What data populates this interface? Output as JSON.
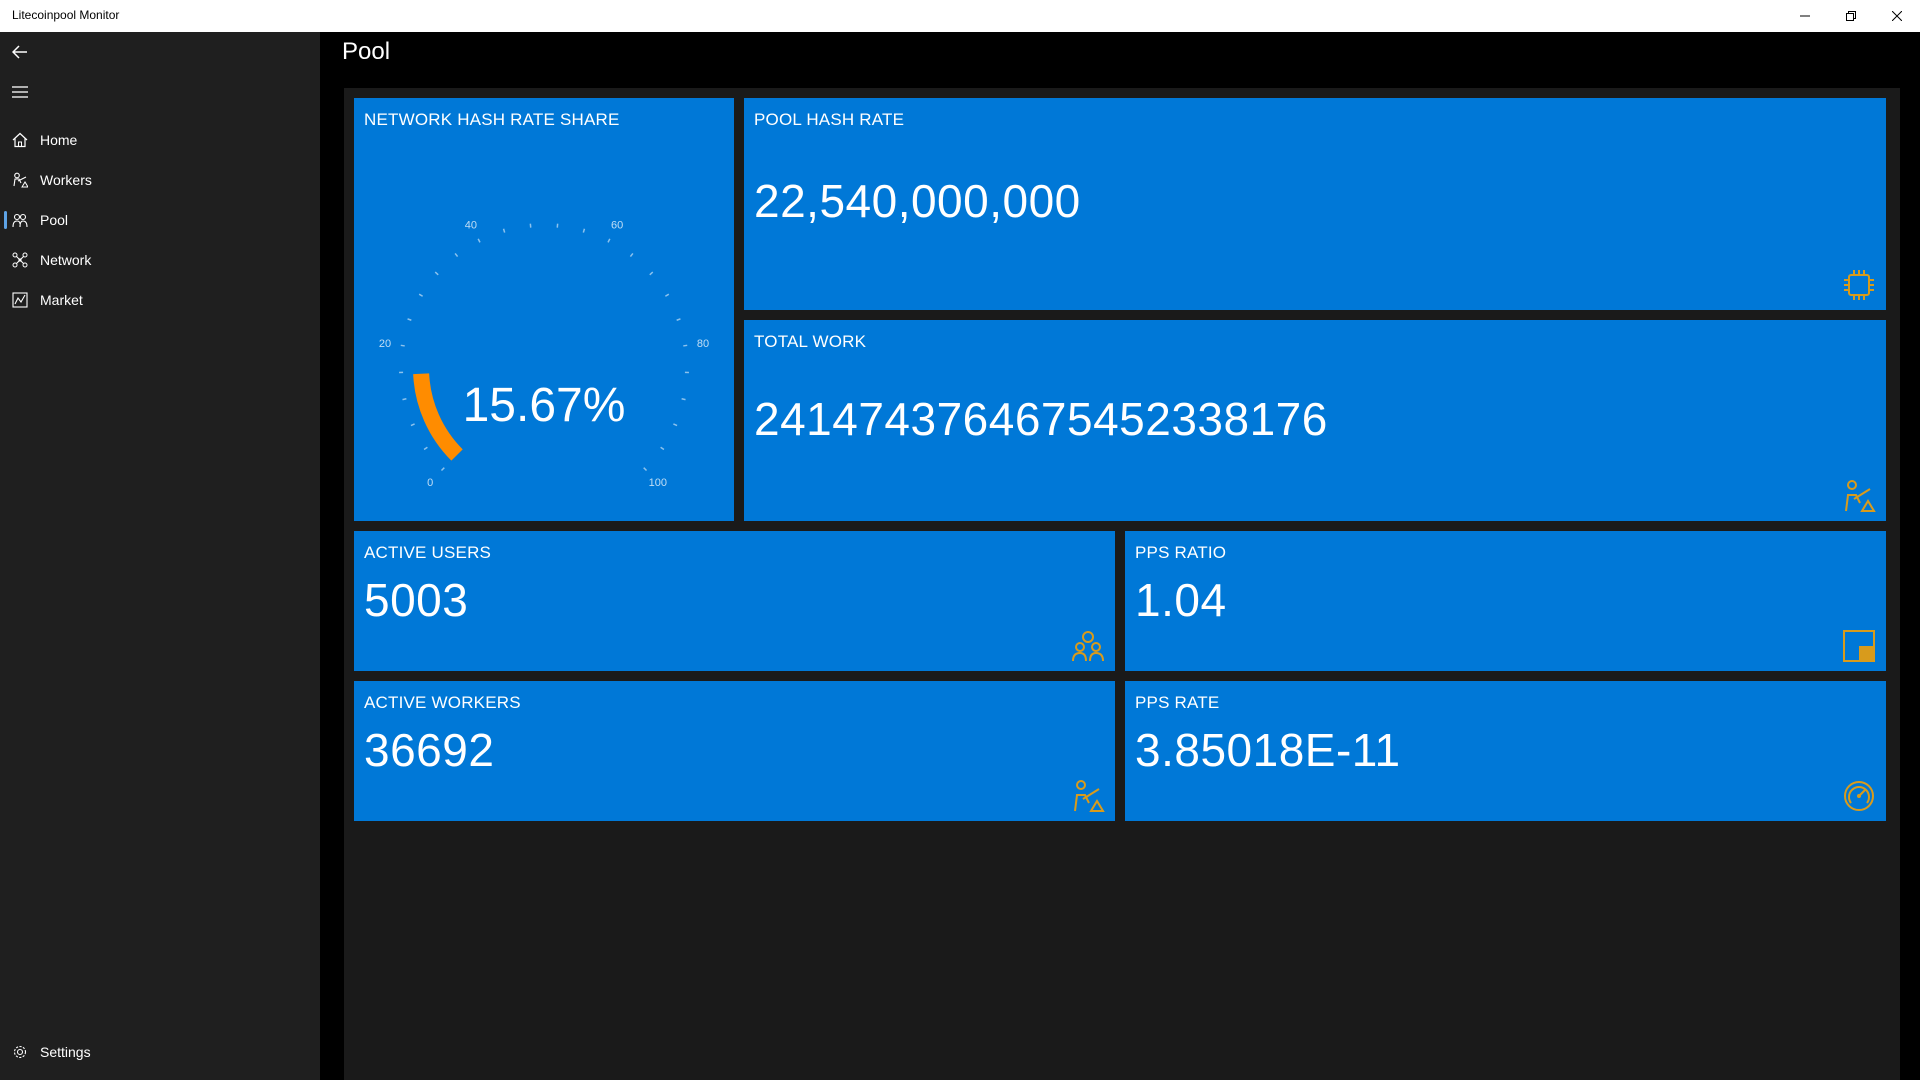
{
  "window": {
    "title": "Litecoinpool Monitor"
  },
  "nav": {
    "items": [
      {
        "label": "Home",
        "icon": "home-icon"
      },
      {
        "label": "Workers",
        "icon": "workers-icon"
      },
      {
        "label": "Pool",
        "icon": "pool-icon",
        "selected": true
      },
      {
        "label": "Network",
        "icon": "network-icon"
      },
      {
        "label": "Market",
        "icon": "market-icon"
      }
    ],
    "settings_label": "Settings"
  },
  "header": {
    "title": "Pool"
  },
  "tiles": {
    "network_share": {
      "label": "NETWORK HASH RATE SHARE",
      "value": "15.67%",
      "gauge_min": 0,
      "gauge_max": 100,
      "gauge_value": 15.67,
      "tick_labels": [
        "0",
        "20",
        "40",
        "60",
        "80",
        "100"
      ]
    },
    "pool_hash_rate": {
      "label": "POOL HASH RATE",
      "value": "22,540,000,000",
      "icon": "cpu-icon"
    },
    "total_work": {
      "label": "TOTAL WORK",
      "value": "241474376467545233817​6",
      "icon": "worker-icon"
    },
    "active_users": {
      "label": "ACTIVE USERS",
      "value": "5003",
      "icon": "users-icon"
    },
    "pps_ratio": {
      "label": "PPS RATIO",
      "value": "1.04",
      "icon": "ratio-icon"
    },
    "active_workers": {
      "label": "ACTIVE WORKERS",
      "value": "36692",
      "icon": "worker-icon"
    },
    "pps_rate": {
      "label": "PPS RATE",
      "value": "3.85018E-11",
      "icon": "speedometer-icon"
    }
  },
  "colors": {
    "tile": "#0078d7",
    "accent_icon": "#d89b1c",
    "gauge_fill": "#ff8c00",
    "nav_bg": "#1f1f1f"
  }
}
